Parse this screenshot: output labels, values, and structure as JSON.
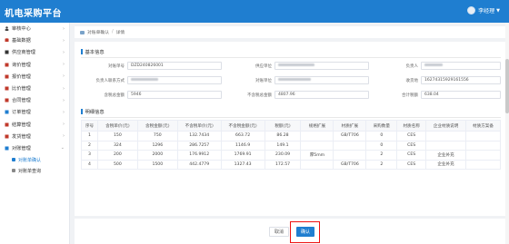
{
  "app": {
    "title": "机电采购平台",
    "user_name": "李经理"
  },
  "sidebar": {
    "items": [
      {
        "label": "审核中心",
        "icon": "person-icon"
      },
      {
        "label": "基础数据",
        "icon": "database-icon"
      },
      {
        "label": "供应商管理",
        "icon": "supplier-icon"
      },
      {
        "label": "询价管理",
        "icon": "inquiry-icon"
      },
      {
        "label": "报价管理",
        "icon": "quote-icon"
      },
      {
        "label": "比价管理",
        "icon": "compare-icon"
      },
      {
        "label": "合同管理",
        "icon": "contract-icon"
      },
      {
        "label": "订单管理",
        "icon": "order-icon"
      },
      {
        "label": "结算管理",
        "icon": "settlement-icon"
      },
      {
        "label": "发货管理",
        "icon": "shipping-icon"
      },
      {
        "label": "对账管理",
        "icon": "reconcile-icon"
      }
    ],
    "subitems": [
      {
        "label": "对账单确认",
        "active": true
      },
      {
        "label": "对账单查询",
        "active": false
      }
    ]
  },
  "breadcrumb": {
    "parent": "对账单确认",
    "current": "详情"
  },
  "basic": {
    "title": "基本信息",
    "fields": [
      {
        "label": "对账单号",
        "value": "DZD240826001"
      },
      {
        "label": "供应单位",
        "value": ""
      },
      {
        "label": "负责人",
        "value": ""
      },
      {
        "label": "负责人联系方式",
        "value": ""
      },
      {
        "label": "对账单位",
        "value": ""
      },
      {
        "label": "收货地",
        "value": "16274315929161556"
      },
      {
        "label": "含税总金额",
        "value": "5946"
      },
      {
        "label": "不含税总金额",
        "value": "4807.96"
      },
      {
        "label": "合计税额",
        "value": "638.04"
      }
    ]
  },
  "detail": {
    "title": "明细信息",
    "columns": [
      "序号",
      "含税单价(元)",
      "含税金额(元)",
      "不含税单价(元)",
      "不含税金额(元)",
      "税额(元)",
      "规格扩展",
      "材质扩展",
      "采购数量",
      "材质名称",
      "企业材质说明",
      "材质方案备"
    ],
    "rows": [
      [
        "1",
        "150",
        "750",
        "132.7434",
        "663.72",
        "86.28",
        "",
        "GB/T706",
        "0",
        "CES",
        "",
        ""
      ],
      [
        "2",
        "324",
        "1296",
        "286.7257",
        "1146.9",
        "149.1",
        "",
        "",
        "0",
        "CES",
        "",
        ""
      ],
      [
        "3",
        "200",
        "2000",
        "176.9912",
        "1769.91",
        "230.09",
        "厚5mm",
        "",
        "2",
        "CES",
        "企业补充",
        ""
      ],
      [
        "4",
        "500",
        "1500",
        "442.4779",
        "1327.43",
        "172.57",
        "",
        "GB/T706",
        "2",
        "CES",
        "企业补充",
        ""
      ]
    ]
  },
  "footer": {
    "cancel_label": "取消",
    "confirm_label": "确认"
  },
  "colors": {
    "brand": "#1f7ed0",
    "highlight": "#e11111"
  }
}
